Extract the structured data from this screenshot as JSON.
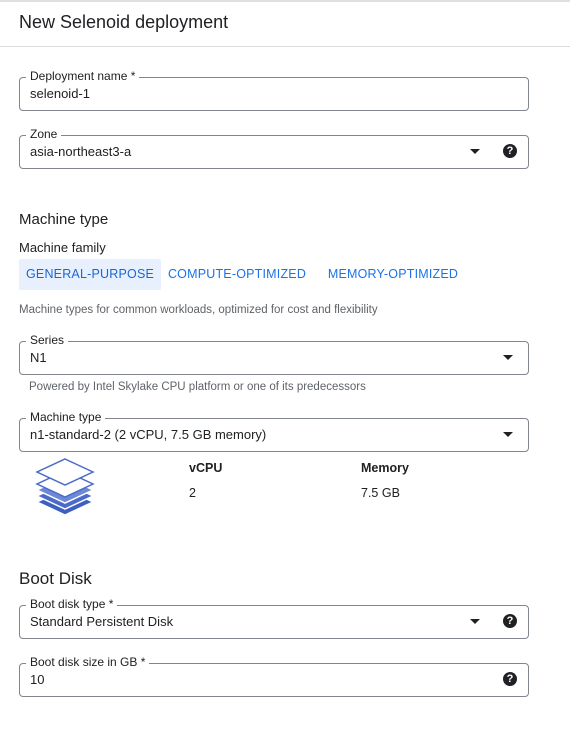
{
  "header": {
    "title": "New Selenoid deployment"
  },
  "deployment_name": {
    "label": "Deployment name *",
    "value": "selenoid-1"
  },
  "zone": {
    "label": "Zone",
    "value": "asia-northeast3-a",
    "help_icon": "?"
  },
  "machine_type_section": {
    "title": "Machine type",
    "family_label": "Machine family",
    "tabs": [
      {
        "label": "GENERAL-PURPOSE",
        "active": true
      },
      {
        "label": "COMPUTE-OPTIMIZED",
        "active": false
      },
      {
        "label": "MEMORY-OPTIMIZED",
        "active": false
      }
    ],
    "family_hint": "Machine types for common workloads, optimized for cost and flexibility",
    "series": {
      "label": "Series",
      "value": "N1",
      "hint": "Powered by Intel Skylake CPU platform or one of its predecessors"
    },
    "machine_type": {
      "label": "Machine type",
      "value": "n1-standard-2 (2 vCPU, 7.5 GB memory)"
    },
    "specs": {
      "vcpu_label": "vCPU",
      "vcpu_value": "2",
      "memory_label": "Memory",
      "memory_value": "7.5 GB"
    }
  },
  "boot_disk": {
    "title": "Boot Disk",
    "type": {
      "label": "Boot disk type *",
      "value": "Standard Persistent Disk",
      "help_icon": "?"
    },
    "size": {
      "label": "Boot disk size in GB *",
      "value": "10",
      "help_icon": "?"
    }
  },
  "colors": {
    "accent": "#1a73e8",
    "tab_active_bg": "#e8f0fe",
    "stack_icon": "#4a6bc9"
  }
}
